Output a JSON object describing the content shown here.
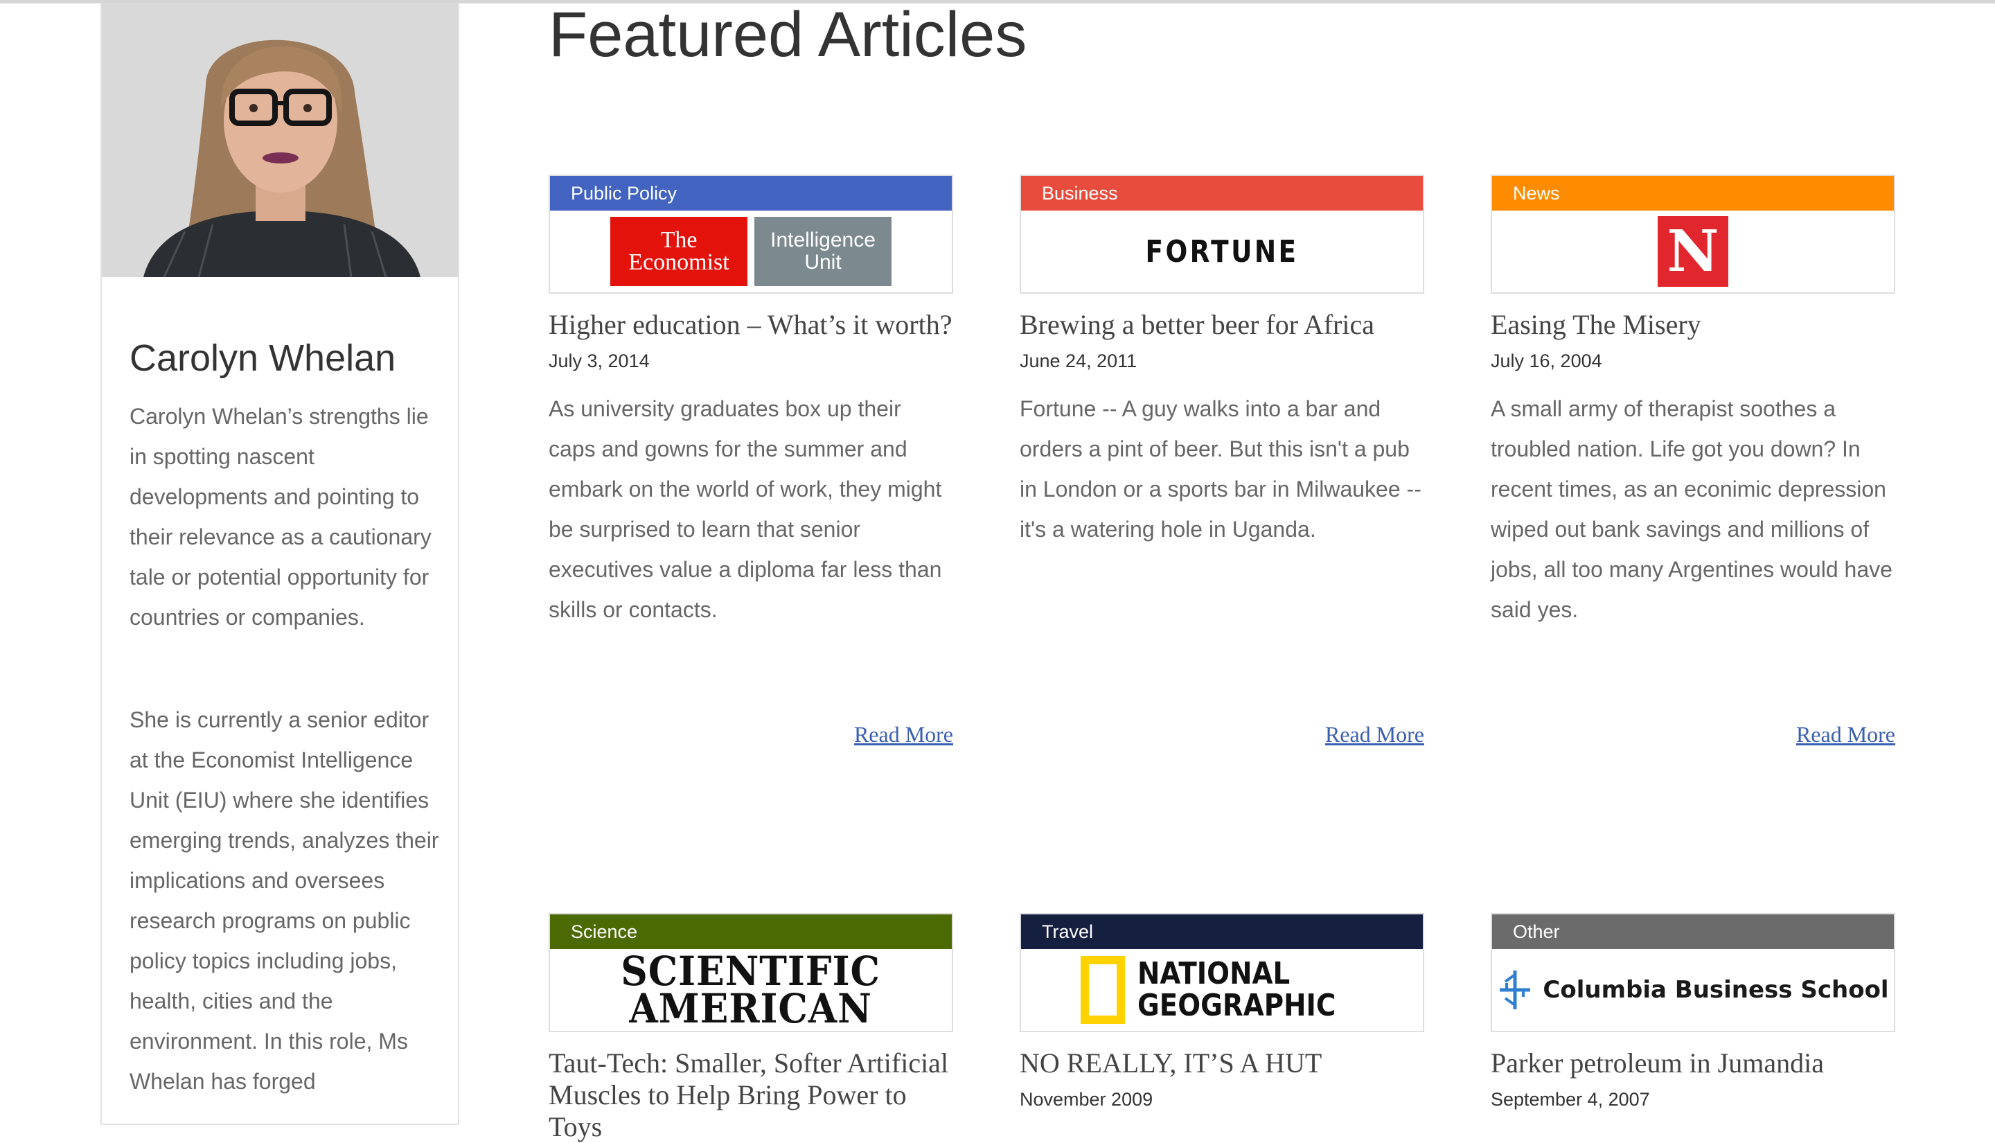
{
  "profile": {
    "photo_alt": "Carolyn Whelan",
    "name": "Carolyn Whelan",
    "bio_paragraph_1": "Carolyn Whelan’s strengths lie in spotting nascent developments and pointing to their relevance as a cautionary tale or potential opportunity for countries or companies.",
    "bio_paragraph_2": "She is currently a senior editor at the Economist Intelligence Unit (EIU) where she identifies emerging trends, analyzes their implications and oversees research programs on public policy topics including jobs, health, cities and the environment. In this role, Ms Whelan has forged"
  },
  "main": {
    "title": "Featured Articles",
    "read_more_label": "Read More",
    "articles": [
      {
        "category": "Public Policy",
        "category_color": "#4263c0",
        "logo": "economist-eiu-logo",
        "logo_text_1a": "The",
        "logo_text_1b": "Economist",
        "logo_text_2a": "Intelligence",
        "logo_text_2b": "Unit",
        "title": "Higher education – What’s it worth?",
        "date": "July 3, 2014",
        "summary": "As university graduates box up their caps and gowns for the summer and embark on the world of work, they might be surprised to learn that senior executives value a diploma far less than skills or contacts."
      },
      {
        "category": "Business",
        "category_color": "#e84c3d",
        "logo": "fortune-logo",
        "logo_text": "FORTUNE",
        "title": "Brewing a better beer for Africa",
        "date": "June 24, 2011",
        "summary": "Fortune -- A guy walks into a bar and orders a pint of beer. But this isn't a pub in London or a sports bar in Milwaukee -- it's a watering hole in Uganda."
      },
      {
        "category": "News",
        "category_color": "#ff8c00",
        "logo": "newsweek-logo",
        "logo_text": "N",
        "title": "Easing The Misery",
        "date": "July 16, 2004",
        "summary": "A small army of therapist soothes a troubled nation. Life got you down? In recent times, as an econimic depression wiped out bank savings and millions of jobs, all too many Argentines would have said yes."
      },
      {
        "category": "Science",
        "category_color": "#4b6a04",
        "logo": "scientific-american-logo",
        "logo_text_1": "SCIENTIFIC",
        "logo_text_2": "AMERICAN",
        "title": "Taut-Tech: Smaller, Softer Artificial Muscles to Help Bring Power to Toys",
        "date": "",
        "summary": ""
      },
      {
        "category": "Travel",
        "category_color": "#152041",
        "logo": "national-geographic-logo",
        "logo_text_1": "NATIONAL",
        "logo_text_2": "GEOGRAPHIC",
        "title": "NO REALLY, IT’S A HUT",
        "date": "November 2009",
        "summary": ""
      },
      {
        "category": "Other",
        "category_color": "#6b6b6b",
        "logo": "columbia-business-school-logo",
        "logo_text": "Columbia Business School",
        "title": "Parker petroleum in Jumandia",
        "date": "September 4, 2007",
        "summary": ""
      }
    ]
  }
}
